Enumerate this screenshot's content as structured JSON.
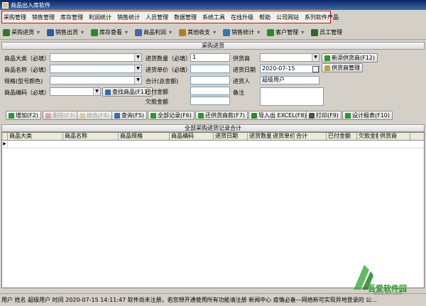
{
  "window": {
    "title": "商品出入库软件"
  },
  "menu": [
    "采购管理",
    "销售管理",
    "库存管理",
    "利润统计",
    "销售统计",
    "人员管理",
    "数据管理",
    "系统工具",
    "在线升级",
    "帮助",
    "公司网站",
    "系列软件产品"
  ],
  "toolbar": [
    {
      "label": "采购进货",
      "icon": "cart-icon",
      "color": "#2a7a2a"
    },
    {
      "label": "销售出货",
      "icon": "sales-icon",
      "color": "#2a5ab0"
    },
    {
      "label": "库存查看",
      "icon": "stock-icon",
      "color": "#2a8a2a"
    },
    {
      "label": "商品利润",
      "icon": "profit-icon",
      "color": "#3a6ab0"
    },
    {
      "label": "其他收支",
      "icon": "money-icon",
      "color": "#b08020"
    },
    {
      "label": "销售统计",
      "icon": "chart-icon",
      "color": "#2a7ab0"
    },
    {
      "label": "客户管理",
      "icon": "customer-icon",
      "color": "#2a8a2a"
    },
    {
      "label": "员工管理",
      "icon": "staff-icon",
      "color": "#2a6a2a"
    }
  ],
  "form": {
    "header": "采购进货",
    "category_label": "商品大类（必填）",
    "name_label": "商品名称（必填）",
    "spec_label": "规格(型号颜色)",
    "code_label": "商品编码（必填）",
    "find_button": "查找商品(F11)",
    "qty_label": "进货数量（必填）",
    "qty_value": "1",
    "price_label": "进货单价（必填）",
    "total_label": "合计(总金额)",
    "paid_label": "已付金额",
    "owed_label": "欠款金额",
    "supplier_label": "供货商",
    "date_label": "进货日期",
    "date_value": "2020-07-15",
    "buyer_label": "进货人",
    "buyer_value": "超级用户",
    "note_label": "备注",
    "add_supplier": "新添供货商(F12)",
    "supplier_mgmt": "供货商管理"
  },
  "actions": [
    {
      "label": "增加(F2)",
      "icon": "plus-icon",
      "enabled": true,
      "color": "#2a9a2a"
    },
    {
      "label": "删除(F3)",
      "icon": "delete-icon",
      "enabled": false,
      "color": "#c04040"
    },
    {
      "label": "修改(F4)",
      "icon": "edit-icon",
      "enabled": false,
      "color": "#c0a040"
    },
    {
      "label": "查询(F5)",
      "icon": "search-icon",
      "enabled": true,
      "color": "#3a6ab0"
    },
    {
      "label": "全部记录(F6)",
      "icon": "check-icon",
      "enabled": true,
      "color": "#2a9a2a"
    },
    {
      "label": "还供货商款(F7)",
      "icon": "return-icon",
      "enabled": true,
      "color": "#2a9a2a"
    },
    {
      "label": "导入出 EXCEL(F8)",
      "icon": "excel-icon",
      "enabled": true,
      "color": "#2a8a2a"
    },
    {
      "label": "打印(F9)",
      "icon": "print-icon",
      "enabled": true,
      "color": "#505050"
    },
    {
      "label": "设计报表(F10)",
      "icon": "report-icon",
      "enabled": true,
      "color": "#2a9a2a"
    }
  ],
  "grid": {
    "header": "全部采购进货记录合计",
    "columns": [
      "商品大类",
      "商品名称",
      "商品规格",
      "商品编码",
      "进货日期",
      "进货数量",
      "进货单价",
      "合计",
      "已付金额",
      "欠款金额",
      "供货商"
    ]
  },
  "status": {
    "text": "用户   姓名   超级用户   时间   2020-07-15 14:11:47  软件尚未注册，若您想开通使用所有功能请注册   新闻中心   疫情必备—网络新可实现异地登录的 公..."
  },
  "watermark": {
    "title": "吾爱软件园",
    "sub": "www.dm.com"
  }
}
